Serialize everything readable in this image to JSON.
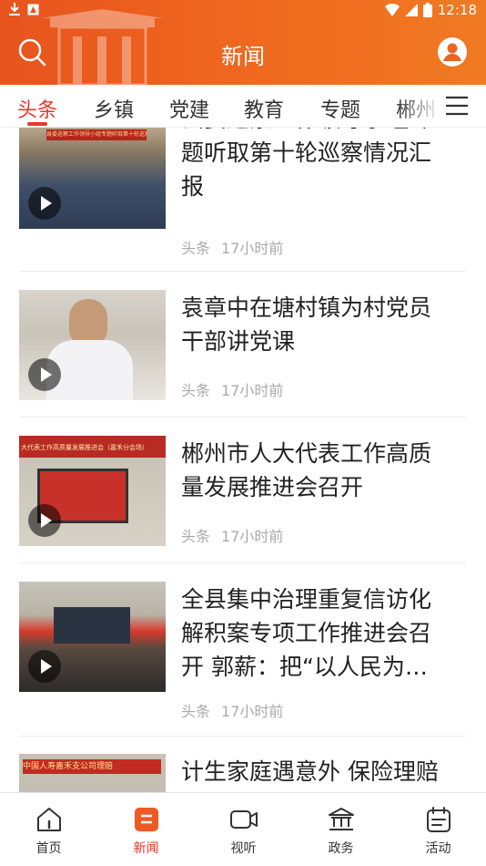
{
  "status_bar": {
    "time": "12:18"
  },
  "header": {
    "title": "新闻"
  },
  "tabs": [
    {
      "label": "头条",
      "active": true
    },
    {
      "label": "乡镇",
      "active": false
    },
    {
      "label": "党建",
      "active": false
    },
    {
      "label": "教育",
      "active": false
    },
    {
      "label": "专题",
      "active": false
    },
    {
      "label": "郴州",
      "active": false
    }
  ],
  "news": [
    {
      "title": "县委巡察工作领导小组专题听取第十轮巡察情况汇报",
      "title_lines": [
        "县委巡察工作领导小组专",
        "题听取第十轮巡察情况汇",
        "报"
      ],
      "source": "头条",
      "time": "17小时前",
      "thumb_caption": "县委巡察工作领导小组专题听取第十轮巡察情况汇报会"
    },
    {
      "title": "袁章中在塘村镇为村党员干部讲党课",
      "title_lines": [
        "袁章中在塘村镇为村党员",
        "干部讲党课"
      ],
      "source": "头条",
      "time": "17小时前"
    },
    {
      "title": "郴州市人大代表工作高质量发展推进会召开",
      "title_lines": [
        "郴州市人大代表工作高质",
        "量发展推进会召开"
      ],
      "source": "头条",
      "time": "17小时前",
      "thumb_caption": "大代表工作高质量发展推进会（嘉禾分会场）"
    },
    {
      "title": "全县集中治理重复信访化解积案专项工作推进会召开 郭薪：把“以人民为…",
      "title_lines": [
        "全县集中治理重复信访化",
        "解积案专项工作推进会召",
        "开  郭薪：把“以人民为…"
      ],
      "source": "头条",
      "time": "17小时前"
    },
    {
      "title": "计生家庭遇意外  保险理赔",
      "title_lines": [
        "计生家庭遇意外  保险理赔"
      ],
      "thumb_caption": "中国人寿嘉禾支公司理赔"
    }
  ],
  "bottom_nav": [
    {
      "label": "首页",
      "icon": "home-icon",
      "active": false
    },
    {
      "label": "新闻",
      "icon": "news-icon",
      "active": true
    },
    {
      "label": "视听",
      "icon": "video-icon",
      "active": false
    },
    {
      "label": "政务",
      "icon": "government-icon",
      "active": false
    },
    {
      "label": "活动",
      "icon": "calendar-icon",
      "active": false
    }
  ],
  "colors": {
    "brand": "#e8531e",
    "active": "#e8372a",
    "meta": "#aaaaaa"
  }
}
